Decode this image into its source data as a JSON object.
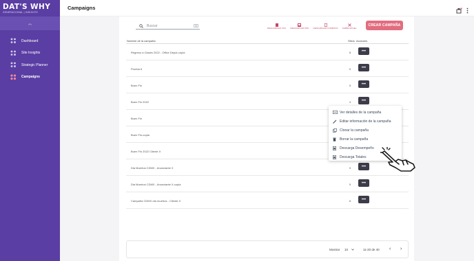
{
  "brand": {
    "logo_main": "DAT'S WHY",
    "logo_sub": "GENERACIONAL | INSIGHTS"
  },
  "sidebar": {
    "collapse_icon": "chevrons-up-icon",
    "items": [
      {
        "label": "Dashboard",
        "icon": "grid-icon",
        "active": false
      },
      {
        "label": "Site Insights",
        "icon": "grid-icon",
        "active": false
      },
      {
        "label": "Strategic Planner",
        "icon": "grid-icon",
        "active": false
      },
      {
        "label": "Campaigns",
        "icon": "grid-icon",
        "active": true
      }
    ]
  },
  "header": {
    "title": "Campaigns",
    "icons": [
      "notification-icon",
      "more-vert-icon"
    ]
  },
  "search": {
    "placeholder": "Buscar"
  },
  "toolbar": {
    "actions": [
      {
        "label": "DESCARGAR CSV",
        "icon": "file-download-icon"
      },
      {
        "label": "DESCARGAR PDF",
        "icon": "picture-icon"
      },
      {
        "label": "DESCARGAR FORMATO",
        "icon": "document-icon"
      },
      {
        "label": "SUBIR EXCEL",
        "icon": "upload-excel-icon"
      }
    ],
    "create_label": "CREAR CAMPAÑA"
  },
  "table": {
    "headers": {
      "name": "Nombre de la campaña",
      "sites": "Sitios",
      "actions": "Acciones"
    },
    "rows": [
      {
        "name": "Regreso a Clases 2022 - Office Depot-copia",
        "sites": "8",
        "has_action": true
      },
      {
        "name": "Prueba 6",
        "sites": "5",
        "has_action": true
      },
      {
        "name": "Buen Fin",
        "sites": "5",
        "has_action": true
      },
      {
        "name": "Buen Fin 2022",
        "sites": "4",
        "has_action": true
      },
      {
        "name": "Buen Fin",
        "sites": "",
        "has_action": false
      },
      {
        "name": "Buen Fin-copia",
        "sites": "",
        "has_action": false
      },
      {
        "name": "Buen Fin 2022 Cliente X",
        "sites": "",
        "has_action": false
      },
      {
        "name": "Dia Muertos CDMX - Anunciante X",
        "sites": "5",
        "has_action": true
      },
      {
        "name": "Dia Muertos CDMX - Anunciante X-copia",
        "sites": "5",
        "has_action": true
      },
      {
        "name": "Campaña CDMX día muertos - Cliente X",
        "sites": "8",
        "has_action": true
      }
    ],
    "action_glyph": "•••"
  },
  "context_menu": {
    "items": [
      {
        "label": "Ver detalles de la campaña",
        "icon": "details-icon"
      },
      {
        "label": "Editar información de la campaña",
        "icon": "pencil-icon"
      },
      {
        "label": "Clonar la campaña",
        "icon": "copy-icon"
      },
      {
        "label": "Borrar la campaña",
        "icon": "trash-icon"
      },
      {
        "label": "Descarga Desempeño",
        "icon": "download-icon"
      },
      {
        "label": "Descarga Totales",
        "icon": "download-icon"
      }
    ]
  },
  "pagination": {
    "show_label": "Mostrar",
    "page_size": "10",
    "range": "11-20 de 40",
    "prev": "‹",
    "next": "›"
  },
  "colors": {
    "sidebar": "#5a3ea3",
    "accent": "#e26d7f",
    "action_text": "#c44566",
    "more_button": "#3c3c4a"
  }
}
